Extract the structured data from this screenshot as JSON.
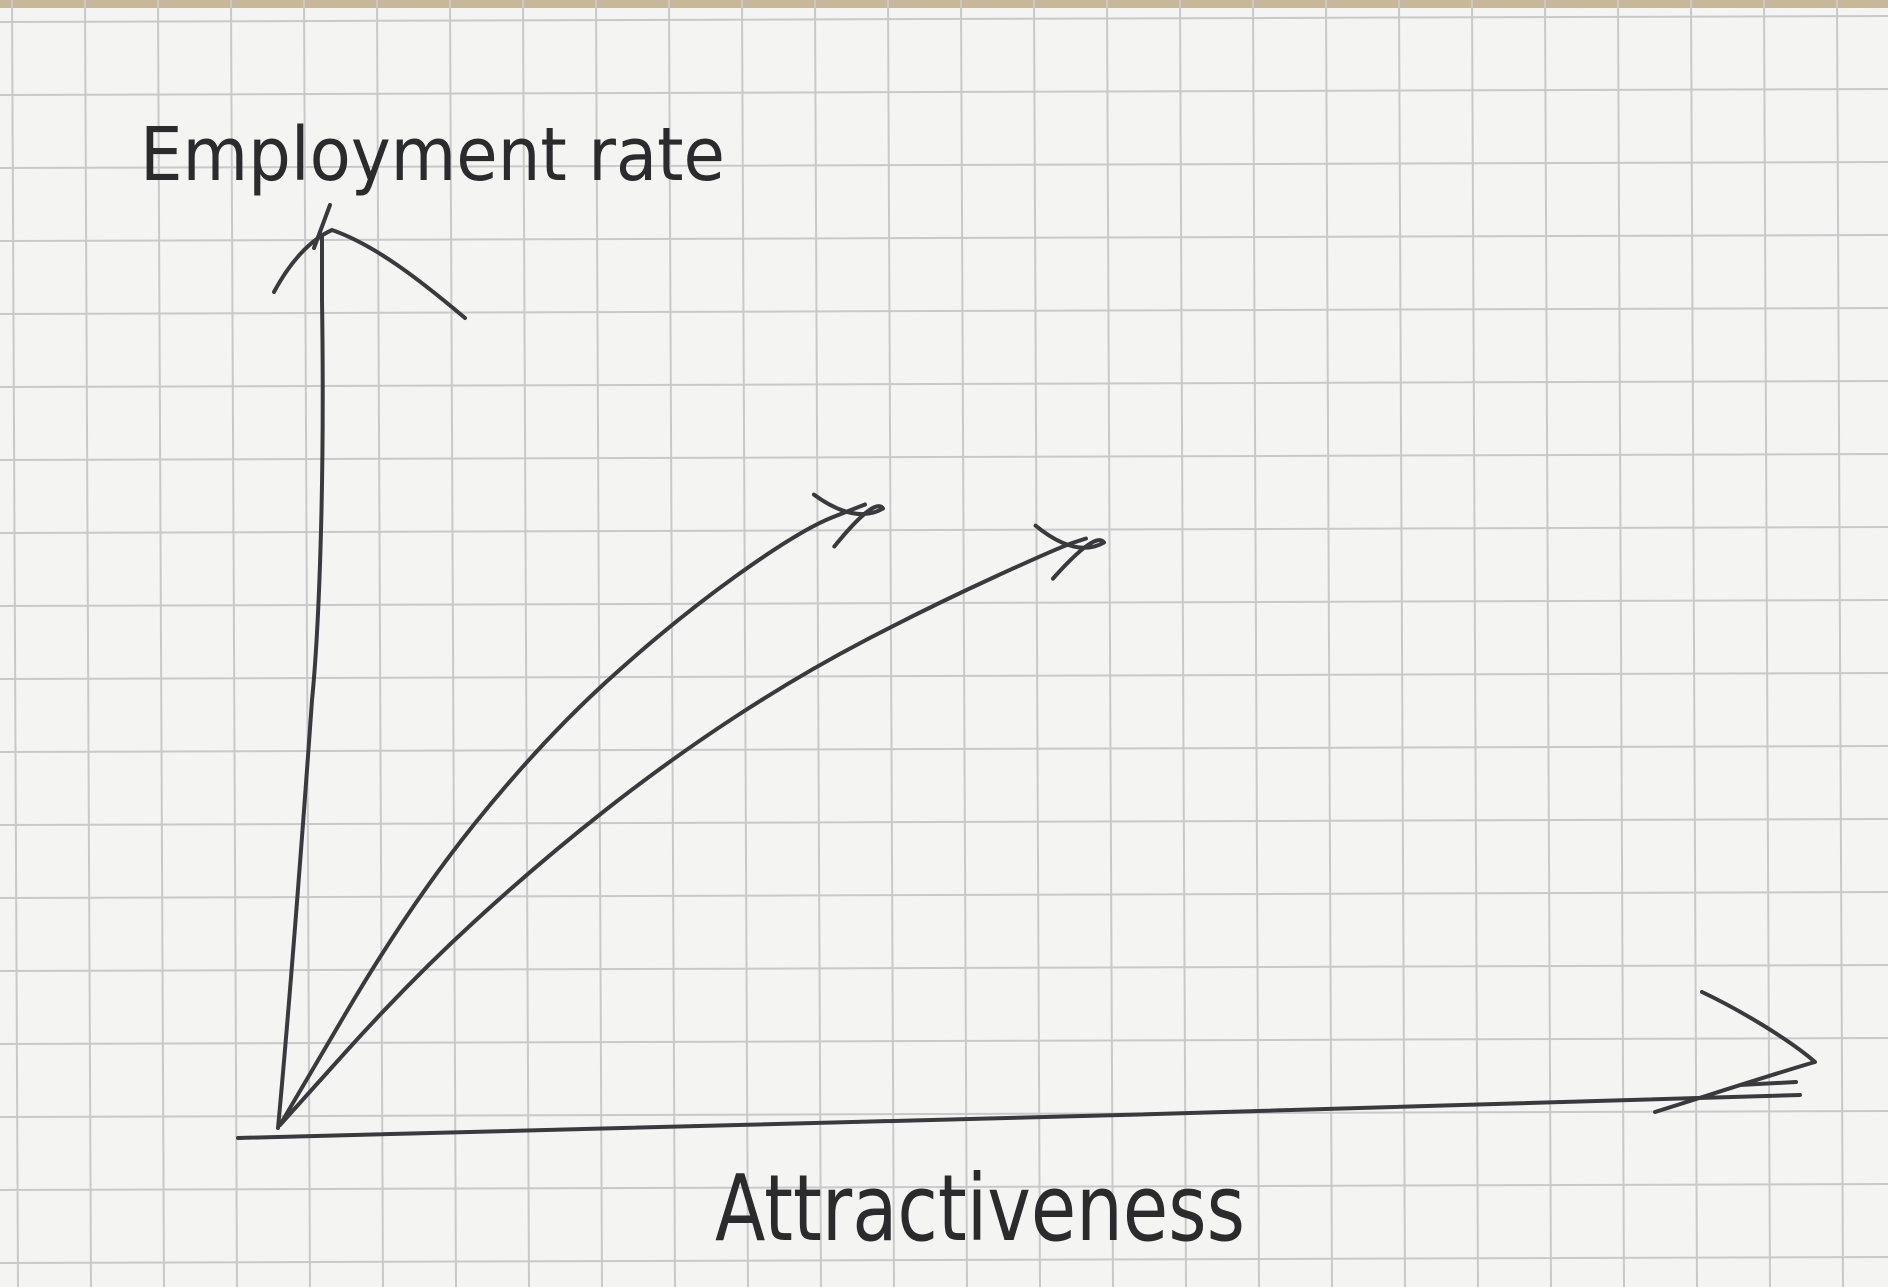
{
  "chart_data": {
    "type": "line",
    "title": "",
    "xlabel": "Attractiveness",
    "ylabel": "Employment rate",
    "xlim": [
      0,
      10
    ],
    "ylim": [
      0,
      10
    ],
    "grid": true,
    "axis_ticks": false,
    "series": [
      {
        "name": "",
        "x": [
          0,
          1,
          2,
          3,
          4,
          4.5
        ],
        "y": [
          0,
          2.6,
          4.5,
          5.9,
          7.0,
          7.3
        ]
      },
      {
        "name": "",
        "x": [
          0,
          1,
          2,
          3,
          4,
          5,
          6,
          6.2
        ],
        "y": [
          0,
          1.7,
          3.1,
          4.3,
          5.3,
          6.1,
          6.8,
          6.9
        ]
      }
    ],
    "colors": {
      "paper": "#f4f4f2",
      "grid": "#c9c9cb",
      "ink": "#3a3a3e"
    }
  }
}
